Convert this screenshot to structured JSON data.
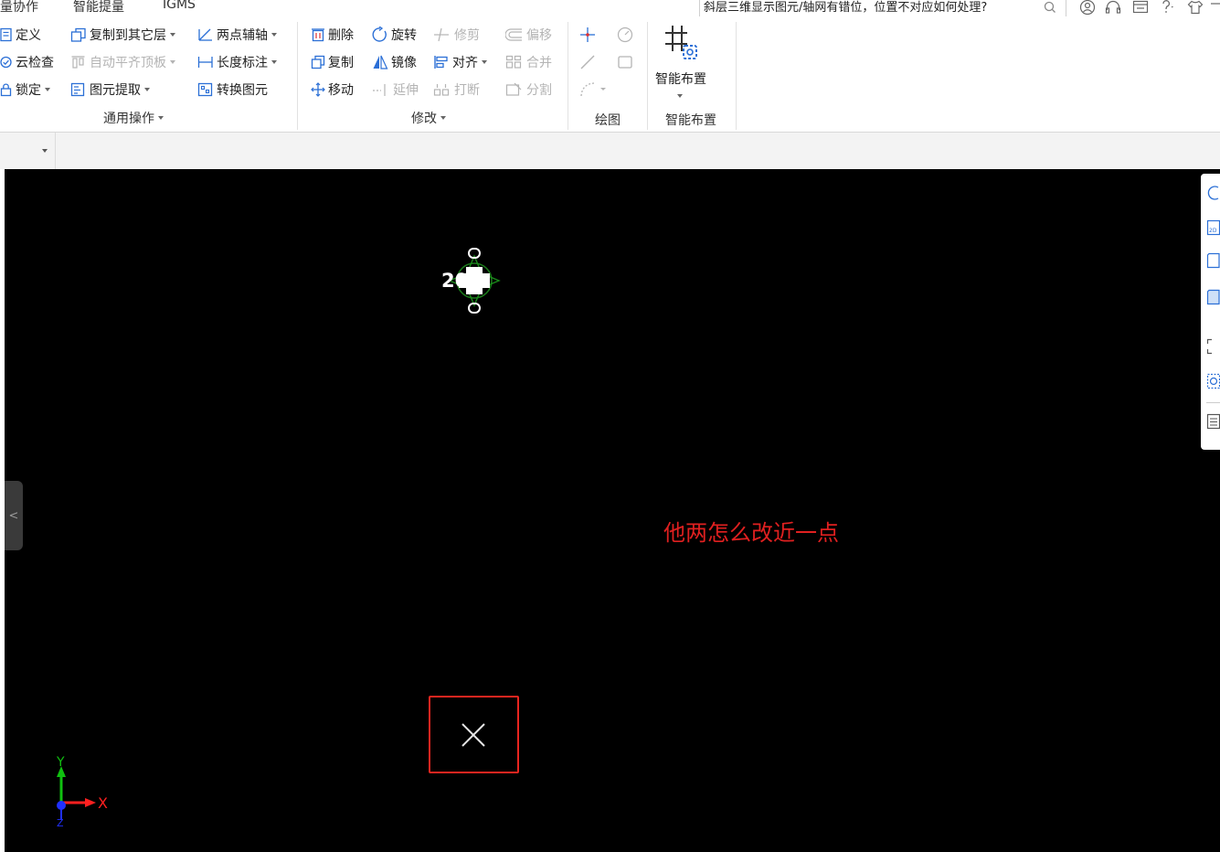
{
  "menu": {
    "items": [
      "量协作",
      "智能提量",
      "IGMS"
    ],
    "search_text": "斜层三维显示图元/轴网有错位，位置不对应如何处理?"
  },
  "ribbon": {
    "general_ops": {
      "label": "通用操作",
      "define": "定义",
      "cloud_check": "云检查",
      "lock": "锁定",
      "copy_to_layer": "复制到其它层",
      "auto_align_slab": "自动平齐顶板",
      "extract_element": "图元提取",
      "two_point_axis": "两点辅轴",
      "length_dimension": "长度标注",
      "convert_element": "转换图元"
    },
    "modify": {
      "label": "修改",
      "delete": "删除",
      "rotate": "旋转",
      "trim": "修剪",
      "offset": "偏移",
      "copy": "复制",
      "mirror": "镜像",
      "align": "对齐",
      "merge": "合并",
      "move": "移动",
      "extend": "延伸",
      "break": "打断",
      "split": "分割"
    },
    "draw": {
      "label": "绘图"
    },
    "smart_layout": {
      "label": "智能布置",
      "button": "智能布置"
    }
  },
  "canvas": {
    "annotation": "他两怎么改近一点",
    "axis": {
      "x": "X",
      "y": "Y",
      "z": "Z"
    },
    "side_toggle": "<",
    "element_label": "200"
  },
  "colors": {
    "canvas_bg": "#000000",
    "annotation": "#e02020",
    "marker_border": "#e8251f",
    "axis_x": "#ff2020",
    "axis_y": "#10c010",
    "axis_z": "#2030ff"
  }
}
